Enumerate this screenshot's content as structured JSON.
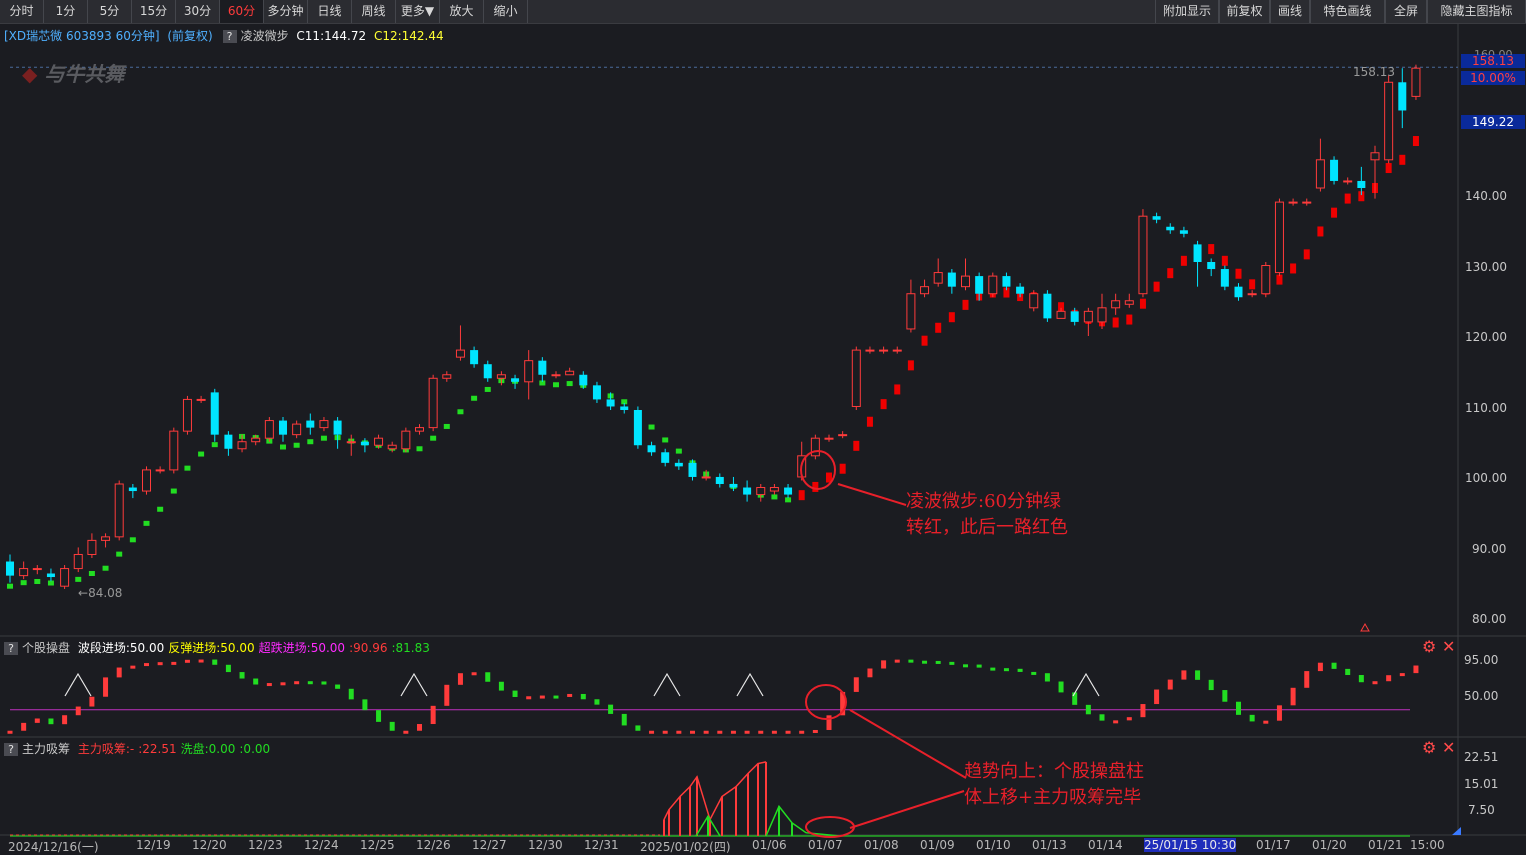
{
  "toolbar": {
    "periods": [
      "分时",
      "1分",
      "5分",
      "15分",
      "30分",
      "60分",
      "多分钟",
      "日线",
      "周线",
      "更多▼",
      "放大",
      "缩小"
    ],
    "active_period": "60分",
    "right_buttons": [
      "附加显示",
      "前复权",
      "画线",
      "特色画线",
      "全屏",
      "隐藏主图指标"
    ]
  },
  "title": {
    "stock": "[XD瑞芯微 603893 60分钟]",
    "adjust": "(前复权)",
    "indicator_name": "凌波微步",
    "c11": "C11:144.72",
    "c12": "C12:142.44"
  },
  "watermark": "与牛共舞",
  "price_axis": {
    "ticks": [
      "140.00",
      "130.00",
      "120.00",
      "110.00",
      "100.00",
      "90.00",
      "80.00"
    ],
    "tag_top": "158.13",
    "tag_pct": "10.00%",
    "tag_mid": "149.22",
    "high_label": "158.13",
    "low_label": "84.08",
    "top_partial": "160.00"
  },
  "indicator1": {
    "name": "个股操盘",
    "items": [
      {
        "text": "波段进场:50.00",
        "color": "#ffffff"
      },
      {
        "text": "反弹进场:50.00",
        "color": "#ffff00"
      },
      {
        "text": "超跌进场:50.00",
        "color": "#ff2bff"
      },
      {
        "text": ":90.96",
        "color": "#ff3b3b"
      },
      {
        "text": ":81.83",
        "color": "#22dd22"
      }
    ],
    "ticks": [
      "95.00",
      "50.00"
    ]
  },
  "indicator2": {
    "name": "主力吸筹",
    "items": [
      {
        "text": "主力吸筹:-",
        "color": "#ff3b3b"
      },
      {
        "text": ":22.51",
        "color": "#ff3b3b"
      },
      {
        "text": "洗盘:0.00",
        "color": "#22dd22"
      },
      {
        "text": ":0.00",
        "color": "#22dd22"
      }
    ],
    "ticks": [
      "22.51",
      "15.01",
      "7.50"
    ]
  },
  "dates": [
    "2024/12/16(一)",
    "12/19",
    "12/20",
    "12/23",
    "12/24",
    "12/25",
    "12/26",
    "12/27",
    "12/30",
    "12/31",
    "2025/01/02(四)",
    "01/06",
    "01/07",
    "01/08",
    "01/09",
    "01/10",
    "01/13",
    "01/14",
    "25/01/15 10:30",
    "01/17",
    "01/20",
    "01/21",
    "15:00"
  ],
  "annotations": {
    "main": [
      "凌波微步:60分钟绿",
      "转红，此后一路红色"
    ],
    "sub": [
      "趋势向上：个股操盘柱",
      "体上移+主力吸筹完毕"
    ]
  },
  "colors": {
    "up": "#ff3b3b",
    "down": "#00e5ff",
    "red_line": "#ee0000",
    "green_line": "#22dd22",
    "annotation": "#e8202a",
    "purple_line": "#c030c0"
  },
  "chart_data": {
    "type": "candlestick",
    "candles": [
      [
        88,
        86,
        89,
        85
      ],
      [
        86,
        87,
        88,
        85.5
      ],
      [
        87,
        87,
        87.5,
        86.2
      ],
      [
        86.3,
        85.8,
        87,
        85.2
      ],
      [
        84.5,
        87,
        87.5,
        84.1
      ],
      [
        87,
        89,
        90,
        86.5
      ],
      [
        89,
        91,
        92,
        88.5
      ],
      [
        91,
        91.5,
        92,
        90
      ],
      [
        91.5,
        99,
        99.5,
        91
      ],
      [
        98.5,
        98,
        99,
        97
      ],
      [
        98,
        101,
        101.5,
        97.5
      ],
      [
        101,
        101,
        101.5,
        100.5
      ],
      [
        101,
        106.5,
        107,
        100.5
      ],
      [
        106.5,
        111,
        111.5,
        106
      ],
      [
        111,
        111,
        111.5,
        110.5
      ],
      [
        112,
        106,
        112.5,
        105
      ],
      [
        106,
        104,
        106.5,
        103
      ],
      [
        104,
        105,
        106,
        103.5
      ],
      [
        105,
        105.5,
        106,
        104.5
      ],
      [
        105.5,
        108,
        108.5,
        105
      ],
      [
        108,
        106,
        108.5,
        105
      ],
      [
        106,
        107.5,
        108,
        105.5
      ],
      [
        108,
        107,
        109,
        106
      ],
      [
        107,
        108,
        108.5,
        106.5
      ],
      [
        108,
        106,
        108.5,
        104
      ],
      [
        105,
        105,
        106,
        103
      ],
      [
        105,
        104.5,
        105.5,
        103.5
      ],
      [
        104.5,
        105.5,
        106,
        104
      ],
      [
        104,
        104.5,
        105,
        103.5
      ],
      [
        104,
        106.5,
        107,
        103.5
      ],
      [
        106.5,
        107,
        107.5,
        106
      ],
      [
        107,
        114,
        114.5,
        106.5
      ],
      [
        114,
        114.5,
        115,
        113.5
      ],
      [
        117,
        118,
        121.5,
        116.5
      ],
      [
        118,
        116,
        118.5,
        115.5
      ],
      [
        116,
        114,
        116.5,
        113.5
      ],
      [
        114,
        114.5,
        115,
        113
      ],
      [
        114,
        113.5,
        114.5,
        112.5
      ],
      [
        113.5,
        116.5,
        118,
        111
      ],
      [
        116.5,
        114.5,
        117,
        113.5
      ],
      [
        114.5,
        114.5,
        115,
        114
      ],
      [
        114.5,
        115,
        115.5,
        114.5
      ],
      [
        114.5,
        113,
        115,
        112.5
      ],
      [
        113,
        111,
        113.5,
        110.5
      ],
      [
        111,
        110,
        112,
        109.5
      ],
      [
        110,
        109.5,
        110.5,
        109
      ],
      [
        109.5,
        104.5,
        110,
        104
      ],
      [
        104.5,
        103.5,
        105,
        103
      ],
      [
        103.5,
        102,
        104,
        101.5
      ],
      [
        102,
        101.5,
        102.5,
        101
      ],
      [
        102,
        100,
        102.5,
        99.5
      ],
      [
        100,
        100,
        101,
        99.5
      ],
      [
        100,
        99,
        100.5,
        98.5
      ],
      [
        99,
        98.5,
        100,
        98
      ],
      [
        98.5,
        97.5,
        99.5,
        96.5
      ],
      [
        97.5,
        98.5,
        99,
        96.5
      ],
      [
        98,
        98.5,
        99,
        97.5
      ],
      [
        98.5,
        97.5,
        99,
        97
      ],
      [
        100,
        103,
        105,
        99.5
      ],
      [
        103,
        105.5,
        106,
        102.5
      ],
      [
        105.5,
        105.5,
        106,
        105
      ],
      [
        106,
        106,
        106.5,
        105.5
      ],
      [
        110,
        118,
        118.5,
        109.5
      ],
      [
        118,
        118,
        118.5,
        117.5
      ],
      [
        118,
        118,
        118.5,
        117.5
      ],
      [
        118,
        118,
        118.5,
        117.5
      ],
      [
        121,
        126,
        128,
        120.5
      ],
      [
        126,
        127,
        128,
        125.5
      ],
      [
        127.5,
        129,
        131,
        127
      ],
      [
        129,
        127,
        129.5,
        126
      ],
      [
        127,
        128.5,
        131,
        126.5
      ],
      [
        128.5,
        126,
        129,
        125
      ],
      [
        126,
        128.5,
        129,
        125.5
      ],
      [
        128.5,
        127,
        129,
        126.5
      ],
      [
        127,
        126,
        127.5,
        125.5
      ],
      [
        124,
        126,
        126.5,
        123.5
      ],
      [
        126,
        122.5,
        126.5,
        122
      ],
      [
        122.5,
        123.5,
        124,
        123
      ],
      [
        123.5,
        122,
        124,
        121.5
      ],
      [
        122,
        123.5,
        124,
        120
      ],
      [
        122,
        124,
        126,
        121
      ],
      [
        124,
        125,
        126,
        123
      ],
      [
        124.5,
        125,
        126,
        124
      ],
      [
        126,
        137,
        138,
        125.5
      ],
      [
        137,
        136.5,
        137.5,
        136
      ],
      [
        135.5,
        135,
        136,
        134.5
      ],
      [
        135,
        134.5,
        135.5,
        134
      ],
      [
        133,
        130.5,
        133.5,
        127
      ],
      [
        130.5,
        129.5,
        131,
        128.5
      ],
      [
        129.5,
        127,
        130,
        126.5
      ],
      [
        127,
        125.5,
        127.5,
        125
      ],
      [
        126,
        126,
        126.5,
        125.5
      ],
      [
        126,
        130,
        130.5,
        125.5
      ],
      [
        129,
        139,
        139.5,
        128.5
      ],
      [
        139,
        139,
        139.5,
        138.5
      ],
      [
        139,
        139,
        139.5,
        138.5
      ],
      [
        141,
        145,
        148,
        140.5
      ],
      [
        145,
        142,
        145.5,
        141.5
      ],
      [
        142,
        142,
        142.5,
        141.5
      ],
      [
        142,
        141,
        144,
        140
      ],
      [
        145,
        146,
        147,
        139.5
      ],
      [
        145,
        156,
        157,
        144.5
      ],
      [
        156,
        152,
        158,
        149.5
      ],
      [
        154,
        158,
        158.5,
        153.5
      ]
    ],
    "lbwb_up_from": 58,
    "ylim": [
      78,
      162
    ],
    "indicator1_ylim": [
      25,
      105
    ],
    "indicator2_ylim": [
      0,
      24
    ]
  }
}
